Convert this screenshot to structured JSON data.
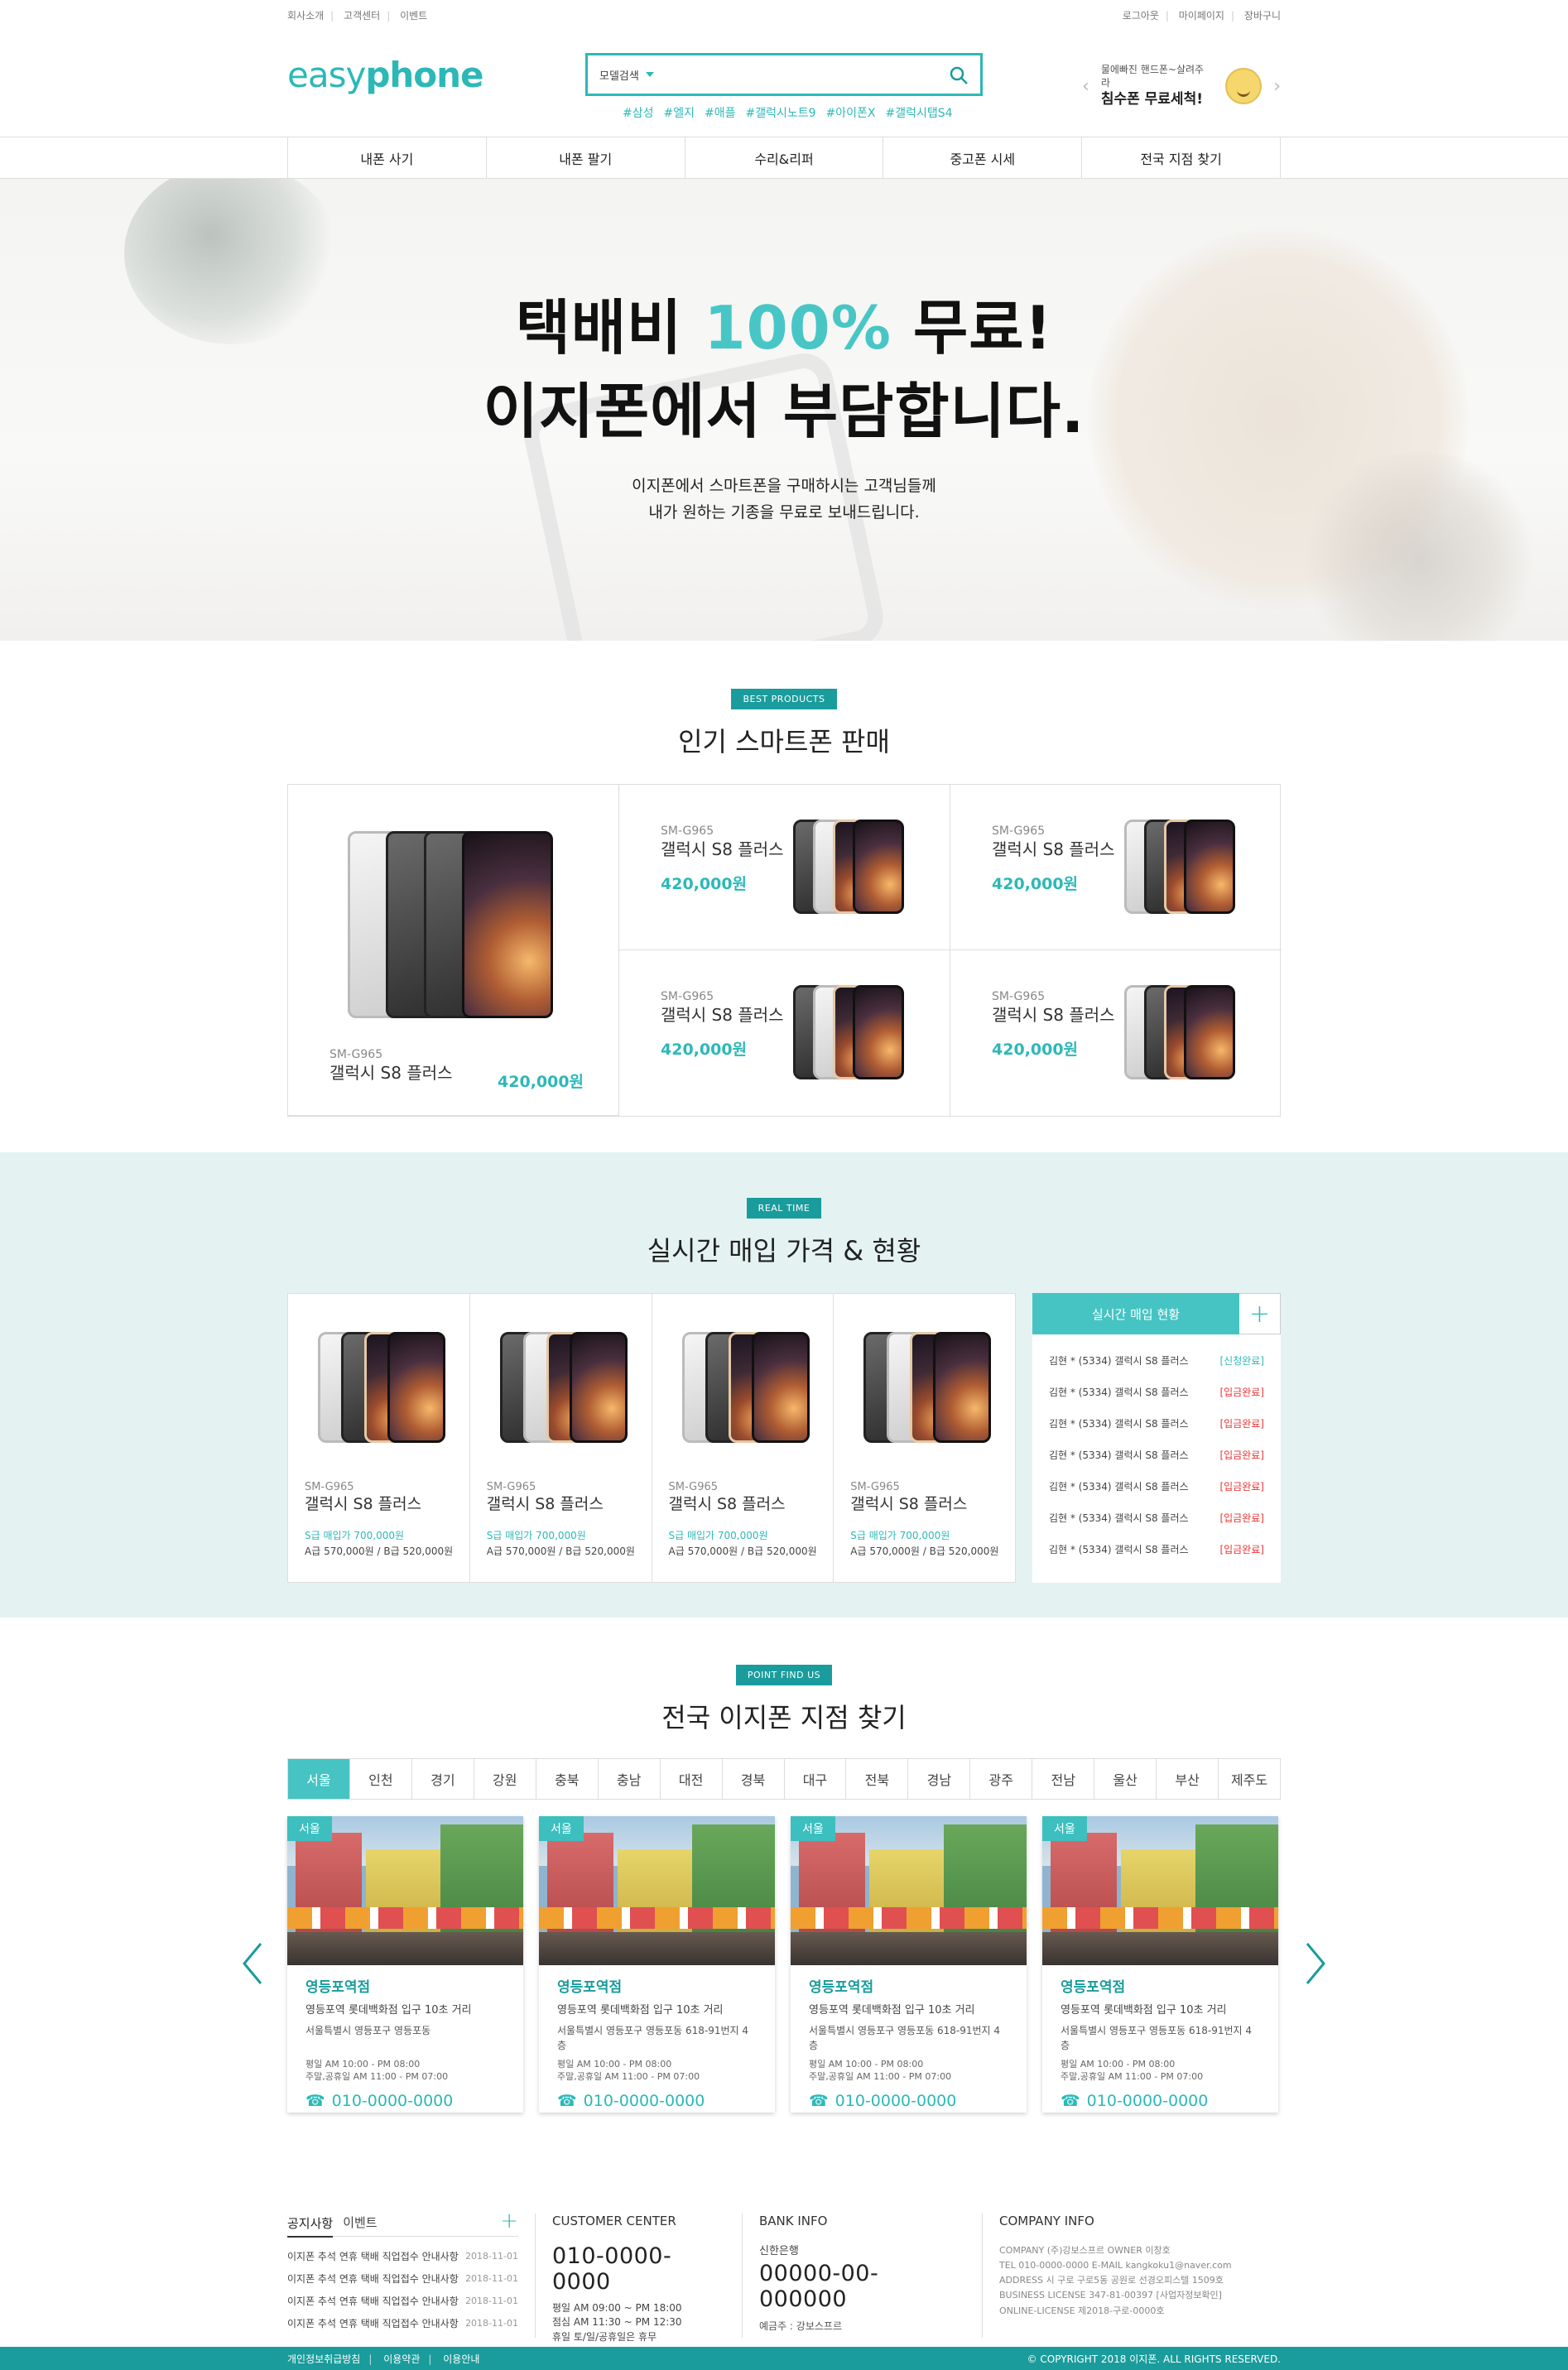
{
  "util": {
    "left": [
      "회사소개",
      "고객센터",
      "이벤트"
    ],
    "right": [
      "로그아웃",
      "마이페이지",
      "장바구니"
    ]
  },
  "header": {
    "logo_light": "easy",
    "logo_bold": "phone",
    "search_category": "모델검색",
    "tags": [
      "#삼성",
      "#엘지",
      "#애플",
      "#갤럭시노트9",
      "#아이폰X",
      "#갤럭시탭S4"
    ],
    "promo_line1": "물에빠진 핸드폰~살려주라",
    "promo_line2": "침수폰 무료세척!"
  },
  "nav": [
    "내폰 사기",
    "내폰 팔기",
    "수리&리퍼",
    "중고폰 시세",
    "전국 지점 찾기"
  ],
  "hero": {
    "line1_a": "택배비 ",
    "line1_hl": "100%",
    "line1_b": " 무료!",
    "line2": "이지폰에서 부담합니다.",
    "sub1": "이지폰에서 스마트폰을 구매하시는 고객님들께",
    "sub2": "내가 원하는 기종을 무료로 보내드립니다."
  },
  "best": {
    "badge": "BEST PRODUCTS",
    "title": "인기 스마트폰 판매",
    "featured": {
      "model": "SM-G965",
      "name": "갤럭시 S8 플러스",
      "price": "420,000원"
    },
    "items": [
      {
        "model": "SM-G965",
        "name": "갤럭시 S8 플러스",
        "price": "420,000원"
      },
      {
        "model": "SM-G965",
        "name": "갤럭시 S8 플러스",
        "price": "420,000원"
      },
      {
        "model": "SM-G965",
        "name": "갤럭시 S8 플러스",
        "price": "420,000원"
      },
      {
        "model": "SM-G965",
        "name": "갤럭시 S8 플러스",
        "price": "420,000원"
      }
    ]
  },
  "realtime": {
    "badge": "REAL TIME",
    "title": "실시간 매입 가격 & 현황",
    "cards": [
      {
        "model": "SM-G965",
        "name": "갤럭시 S8 플러스",
        "grade1": "S급 매입가 700,000원",
        "grade2": "A급 570,000원 / B급 520,000원"
      },
      {
        "model": "SM-G965",
        "name": "갤럭시 S8 플러스",
        "grade1": "S급 매입가 700,000원",
        "grade2": "A급 570,000원 / B급 520,000원"
      },
      {
        "model": "SM-G965",
        "name": "갤럭시 S8 플러스",
        "grade1": "S급 매입가 700,000원",
        "grade2": "A급 570,000원 / B급 520,000원"
      },
      {
        "model": "SM-G965",
        "name": "갤럭시 S8 플러스",
        "grade1": "S급 매입가 700,000원",
        "grade2": "A급 570,000원 / B급 520,000원"
      }
    ],
    "list_title": "실시간 매입 현황",
    "list": [
      {
        "text": "김현 * (5334) 갤럭시 S8 플러스",
        "status": "[신청완료]"
      },
      {
        "text": "김현 * (5334) 갤럭시 S8 플러스",
        "status": "[입금완료]"
      },
      {
        "text": "김현 * (5334) 갤럭시 S8 플러스",
        "status": "[입금완료]"
      },
      {
        "text": "김현 * (5334) 갤럭시 S8 플러스",
        "status": "[입금완료]"
      },
      {
        "text": "김현 * (5334) 갤럭시 S8 플러스",
        "status": "[입금완료]"
      },
      {
        "text": "김현 * (5334) 갤럭시 S8 플러스",
        "status": "[입금완료]"
      },
      {
        "text": "김현 * (5334) 갤럭시 S8 플러스",
        "status": "[입금완료]"
      }
    ]
  },
  "branches": {
    "badge": "POINT FIND US",
    "title": "전국 이지폰 지점 찾기",
    "tabs": [
      "서울",
      "인천",
      "경기",
      "강원",
      "충북",
      "충남",
      "대전",
      "경북",
      "대구",
      "전북",
      "경남",
      "광주",
      "전남",
      "울산",
      "부산",
      "제주도"
    ],
    "active_tab": "서울",
    "stores": [
      {
        "city": "서울",
        "name": "영등포역점",
        "addr": "영등포역 롯데백화점 입구 10초 거리",
        "addr2": "서울특별시 영등포구 영등포동",
        "hours1": "평일 AM 10:00 - PM 08:00",
        "hours2": "주말,공휴일 AM 11:00 - PM 07:00",
        "tel": "010-0000-0000"
      },
      {
        "city": "서울",
        "name": "영등포역점",
        "addr": "영등포역 롯데백화점 입구 10초 거리",
        "addr2": "서울특별시 영등포구 영등포동 618-91번지 4층",
        "hours1": "평일 AM 10:00 - PM 08:00",
        "hours2": "주말,공휴일 AM 11:00 - PM 07:00",
        "tel": "010-0000-0000"
      },
      {
        "city": "서울",
        "name": "영등포역점",
        "addr": "영등포역 롯데백화점 입구 10초 거리",
        "addr2": "서울특별시 영등포구 영등포동 618-91번지 4층",
        "hours1": "평일 AM 10:00 - PM 08:00",
        "hours2": "주말,공휴일 AM 11:00 - PM 07:00",
        "tel": "010-0000-0000"
      },
      {
        "city": "서울",
        "name": "영등포역점",
        "addr": "영등포역 롯데백화점 입구 10초 거리",
        "addr2": "서울특별시 영등포구 영등포동 618-91번지 4층",
        "hours1": "평일 AM 10:00 - PM 08:00",
        "hours2": "주말,공휴일 AM 11:00 - PM 07:00",
        "tel": "010-0000-0000"
      }
    ]
  },
  "footer": {
    "notice_tab": "공지사항",
    "event_tab": "이벤트",
    "notices": [
      {
        "text": "이지폰 추석 연휴 택배 직업접수 안내사항",
        "date": "2018-11-01"
      },
      {
        "text": "이지폰 추석 연휴 택배 직업접수 안내사항",
        "date": "2018-11-01"
      },
      {
        "text": "이지폰 추석 연휴 택배 직업접수 안내사항",
        "date": "2018-11-01"
      },
      {
        "text": "이지폰 추석 연휴 택배 직업접수 안내사항",
        "date": "2018-11-01"
      }
    ],
    "cs_title": "CUSTOMER CENTER",
    "cs_tel": "010-0000-0000",
    "cs_hours": [
      "평일  AM 09:00 ~ PM 18:00",
      "점심  AM 11:30 ~ PM 12:30",
      "휴일  토/일/공휴일은 휴무"
    ],
    "bank_title": "BANK INFO",
    "bank_name": "신한은행",
    "bank_account": "00000-00-000000",
    "bank_holder": "예금주 : 강보스프르",
    "company_title": "COMPANY INFO",
    "company_lines": [
      "COMPANY (주)강보스프르   OWNER 이창호",
      "TEL 010-0000-0000   E-MAIL kangkoku1@naver.com",
      "ADDRESS 시 구로 구로5동 공원로 선경오피스텔 1509호",
      "BUSINESS LICENSE 347-81-00397 [사업자정보확인]",
      "ONLINE-LICENSE 제2018-구로-0000호"
    ],
    "bottom_links": [
      "개인정보취급방침",
      "이용약관",
      "이용안내"
    ],
    "copyright": "© COPYRIGHT 2018 이지폰. ALL RIGHTS RESERVED."
  },
  "colors": {
    "accent": "#2db8b8",
    "accent_dark": "#1a9c9c",
    "mint_bg": "#e4f3f2",
    "status_red": "#e33333"
  },
  "icons": [
    "search-icon",
    "chevron-down-icon",
    "chevron-left-icon",
    "chevron-right-icon",
    "plus-icon",
    "phone-icon"
  ]
}
